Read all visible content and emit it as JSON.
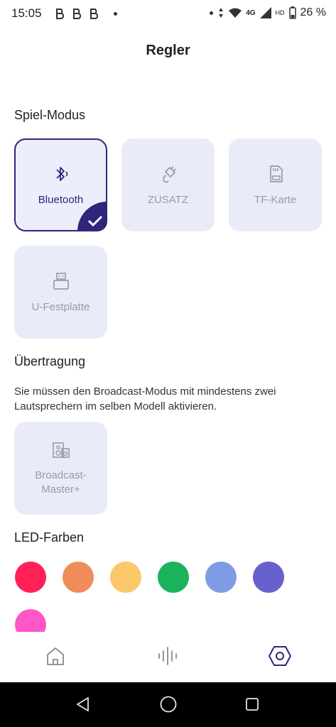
{
  "status_bar": {
    "time": "15:05",
    "battery": "26 %",
    "network": "4G",
    "icons": [
      "notification-icon",
      "notification-icon",
      "notification-icon",
      "dot-icon",
      "vibrate-icon",
      "wifi-icon",
      "signal-icon",
      "hd-icon",
      "battery-icon"
    ]
  },
  "page": {
    "title": "Regler"
  },
  "play_mode": {
    "title": "Spiel-Modus",
    "options": [
      {
        "label": "Bluetooth",
        "icon": "bluetooth-icon",
        "selected": true
      },
      {
        "label": "ZUSATZ",
        "icon": "aux-cable-icon",
        "selected": false
      },
      {
        "label": "TF-Karte",
        "icon": "sd-card-icon",
        "selected": false
      },
      {
        "label": "U-Festplatte",
        "icon": "usb-drive-icon",
        "selected": false
      }
    ]
  },
  "broadcast": {
    "title": "Übertragung",
    "description": "Sie müssen den Broadcast-Modus mit mindestens zwei Lautsprechern im selben Modell aktivieren.",
    "option_label_line1": "Broadcast-",
    "option_label_line2": "Master+",
    "icon": "speaker-icon"
  },
  "led": {
    "title": "LED-Farben",
    "colors": [
      "#ff2156",
      "#ef8c59",
      "#fac86a",
      "#1ab25a",
      "#7f9be3",
      "#6661cc",
      "#ff57c6"
    ]
  },
  "bottom_nav": {
    "items": [
      {
        "icon": "home-icon",
        "active": false
      },
      {
        "icon": "equalizer-icon",
        "active": false
      },
      {
        "icon": "settings-icon",
        "active": true
      }
    ],
    "accent": "#2f2679"
  },
  "system_nav": {
    "items": [
      "back-icon",
      "home-circle-icon",
      "recents-icon"
    ]
  }
}
